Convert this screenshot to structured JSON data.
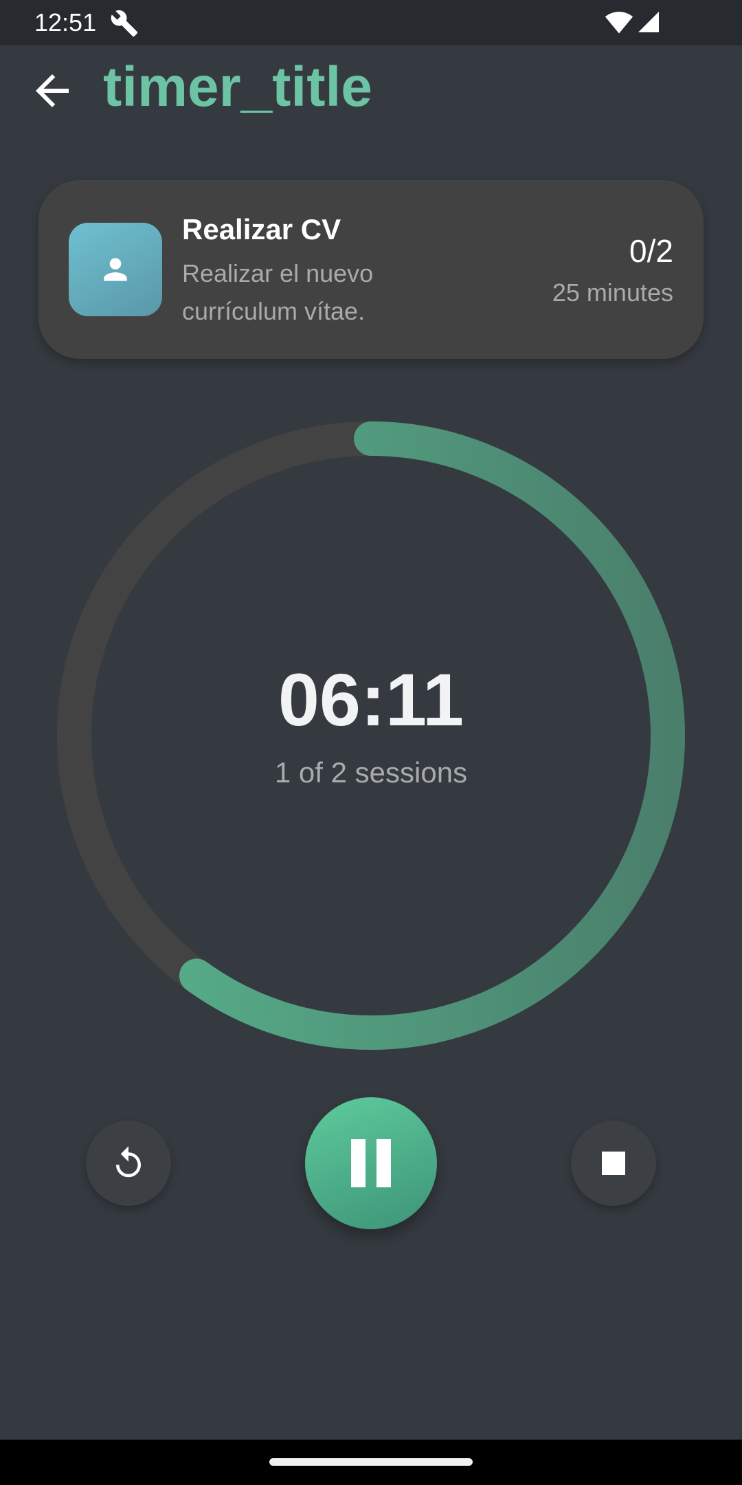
{
  "status_bar": {
    "time": "12:51",
    "icons": [
      "wrench-icon",
      "wifi-icon",
      "cell-signal-icon"
    ]
  },
  "app_bar": {
    "title": "timer_title",
    "back_icon": "arrow-back-icon"
  },
  "task": {
    "title": "Realizar CV",
    "description": "Realizar el nuevo currículum vítae.",
    "sessions_count": "0/2",
    "duration": "25 minutes",
    "avatar_icon": "person-icon"
  },
  "timer": {
    "time": "06:11",
    "sessions": "1 of 2 sessions",
    "progress": 0.6
  },
  "controls": {
    "reset_icon": "reset-icon",
    "pause_icon": "pause-icon",
    "stop_icon": "stop-icon"
  },
  "colors": {
    "background": "#353a40",
    "status_bar": "#272b30",
    "accent": "#6cc4a4",
    "card": "#424242",
    "ring_track": "#434343",
    "ring_progress_start": "#58b48e",
    "ring_progress_end": "#4a7f6c",
    "avatar": "#65aebf"
  }
}
